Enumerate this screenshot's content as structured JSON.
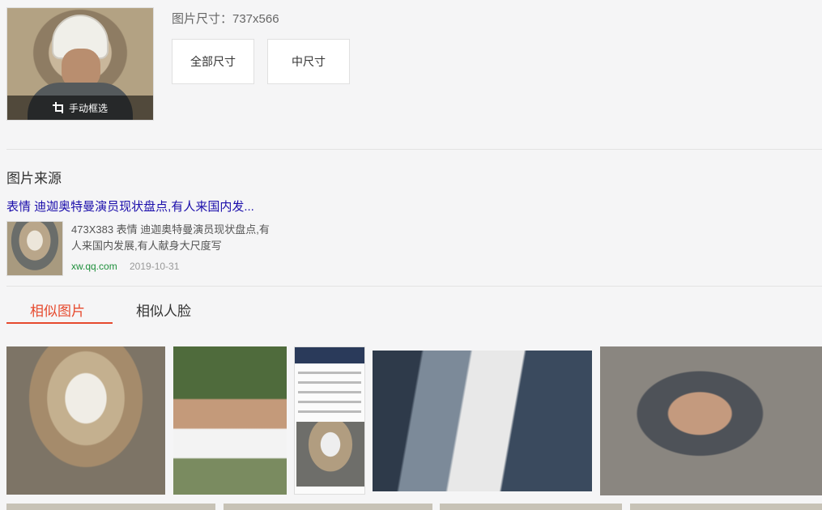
{
  "query_image": {
    "crop_label": "手动框选"
  },
  "size_info": {
    "label": "图片尺寸：737x566",
    "buttons": [
      {
        "label": "全部尺寸"
      },
      {
        "label": "中尺寸"
      }
    ]
  },
  "source": {
    "section_title": "图片来源",
    "link_text": "表情 迪迦奥特曼演员现状盘点,有人来国内发...",
    "description": "473X383 表情 迪迦奥特曼演员现状盘点,有人来国内发展,有人献身大尺度写",
    "site": "xw.qq.com",
    "date": "2019-10-31"
  },
  "tabs": [
    {
      "label": "相似图片",
      "active": true
    },
    {
      "label": "相似人脸",
      "active": false
    }
  ],
  "colors": {
    "accent": "#e64a2e",
    "link": "#1a0dab",
    "site": "#1e8f3b"
  }
}
